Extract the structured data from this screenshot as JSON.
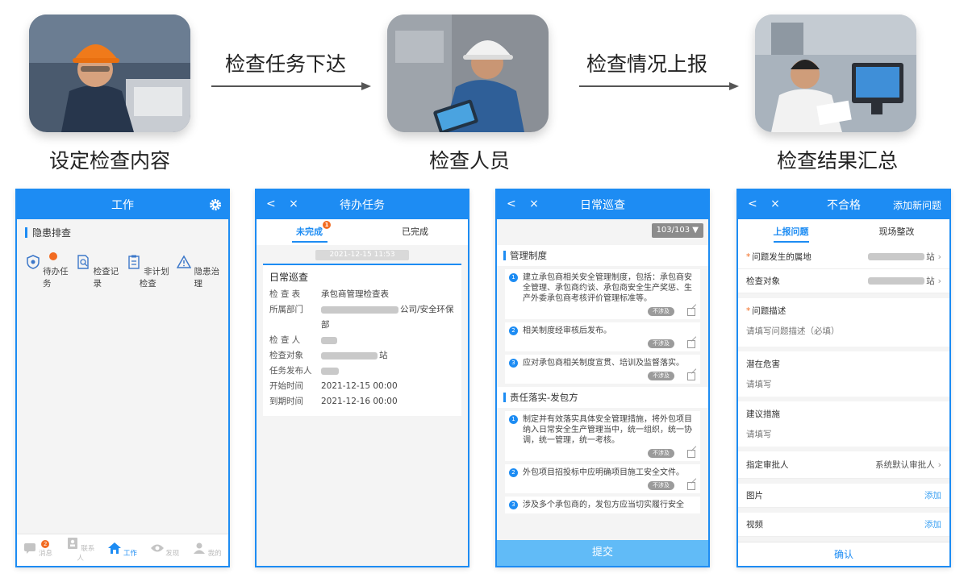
{
  "flow": {
    "stage1_caption": "设定检查内容",
    "stage2_caption": "检查人员",
    "stage3_caption": "检查结果汇总",
    "arrow1_label": "检查任务下达",
    "arrow2_label": "检查情况上报"
  },
  "colors": {
    "primary": "#1d8cf3",
    "badge": "#f26b21",
    "submit": "#61bbf7"
  },
  "phone1": {
    "title": "工作",
    "section": "隐患排查",
    "items": [
      {
        "label": "待办任务",
        "icon": "shield-icon",
        "badge": ""
      },
      {
        "label": "检查记录",
        "icon": "record-doc-icon"
      },
      {
        "label": "非计划检查",
        "icon": "clipboard-icon"
      },
      {
        "label": "隐患治理",
        "icon": "warning-triangle-icon"
      }
    ],
    "tabs": [
      {
        "label": "消息",
        "icon": "message-icon",
        "badge": "2"
      },
      {
        "label": "联系人",
        "icon": "contacts-icon"
      },
      {
        "label": "工作",
        "icon": "home-icon"
      },
      {
        "label": "发现",
        "icon": "eye-icon"
      },
      {
        "label": "我的",
        "icon": "user-icon"
      }
    ]
  },
  "phone2": {
    "title": "待办任务",
    "nav": "<  ×",
    "tab_pending": "未完成",
    "tab_pending_badge": "1",
    "tab_done": "已完成",
    "date_stamp": "2021-12-15 11:53",
    "card_title": "日常巡查",
    "fields": [
      {
        "key": "检 查 表",
        "value": "承包商管理检查表"
      },
      {
        "key": "所属部门",
        "value": "公司/安全环保部"
      },
      {
        "key": "检 查 人",
        "value": ""
      },
      {
        "key": "检查对象",
        "value": "站"
      },
      {
        "key": "任务发布人",
        "value": ""
      },
      {
        "key": "开始时间",
        "value": "2021-12-15 00:00"
      },
      {
        "key": "到期时间",
        "value": "2021-12-16 00:00"
      }
    ]
  },
  "phone3": {
    "title": "日常巡查",
    "nav": "<  ×",
    "counter": "103/103",
    "section1": "管理制度",
    "section2": "责任落实-发包方",
    "items1": [
      {
        "num": "1",
        "text": "建立承包商相关安全管理制度，包括：承包商安全管理、承包商约谈、承包商安全生产奖惩、生产外委承包商考核评价管理标准等。"
      },
      {
        "num": "2",
        "text": "相关制度经审核后发布。"
      },
      {
        "num": "3",
        "text": "应对承包商相关制度宣贯、培训及监督落实。"
      }
    ],
    "items2": [
      {
        "num": "1",
        "text": "制定并有效落实具体安全管理措施，将外包项目纳入日常安全生产管理当中，统一组织，统一协调，统一管理，统一考核。"
      },
      {
        "num": "2",
        "text": "外包项目招投标中应明确项目施工安全文件。"
      },
      {
        "num": "3",
        "text": "涉及多个承包商的，发包方应当切实履行安全"
      }
    ],
    "na_label": "不涉及",
    "submit": "提交"
  },
  "phone4": {
    "title": "不合格",
    "nav": "<  ×",
    "add_issue": "添加新问题",
    "tab_report": "上报问题",
    "tab_fix": "现场整改",
    "location_label": "问题发生的属地",
    "location_value": "站",
    "object_label": "检查对象",
    "object_value": "站",
    "desc_label": "问题描述",
    "desc_placeholder": "请填写问题描述（必填）",
    "hazard_label": "潜在危害",
    "hazard_placeholder": "请填写",
    "measure_label": "建议措施",
    "measure_placeholder": "请填写",
    "approver_label": "指定审批人",
    "approver_value": "系统默认审批人",
    "image_label": "图片",
    "video_label": "视频",
    "add_label": "添加",
    "confirm": "确认"
  }
}
